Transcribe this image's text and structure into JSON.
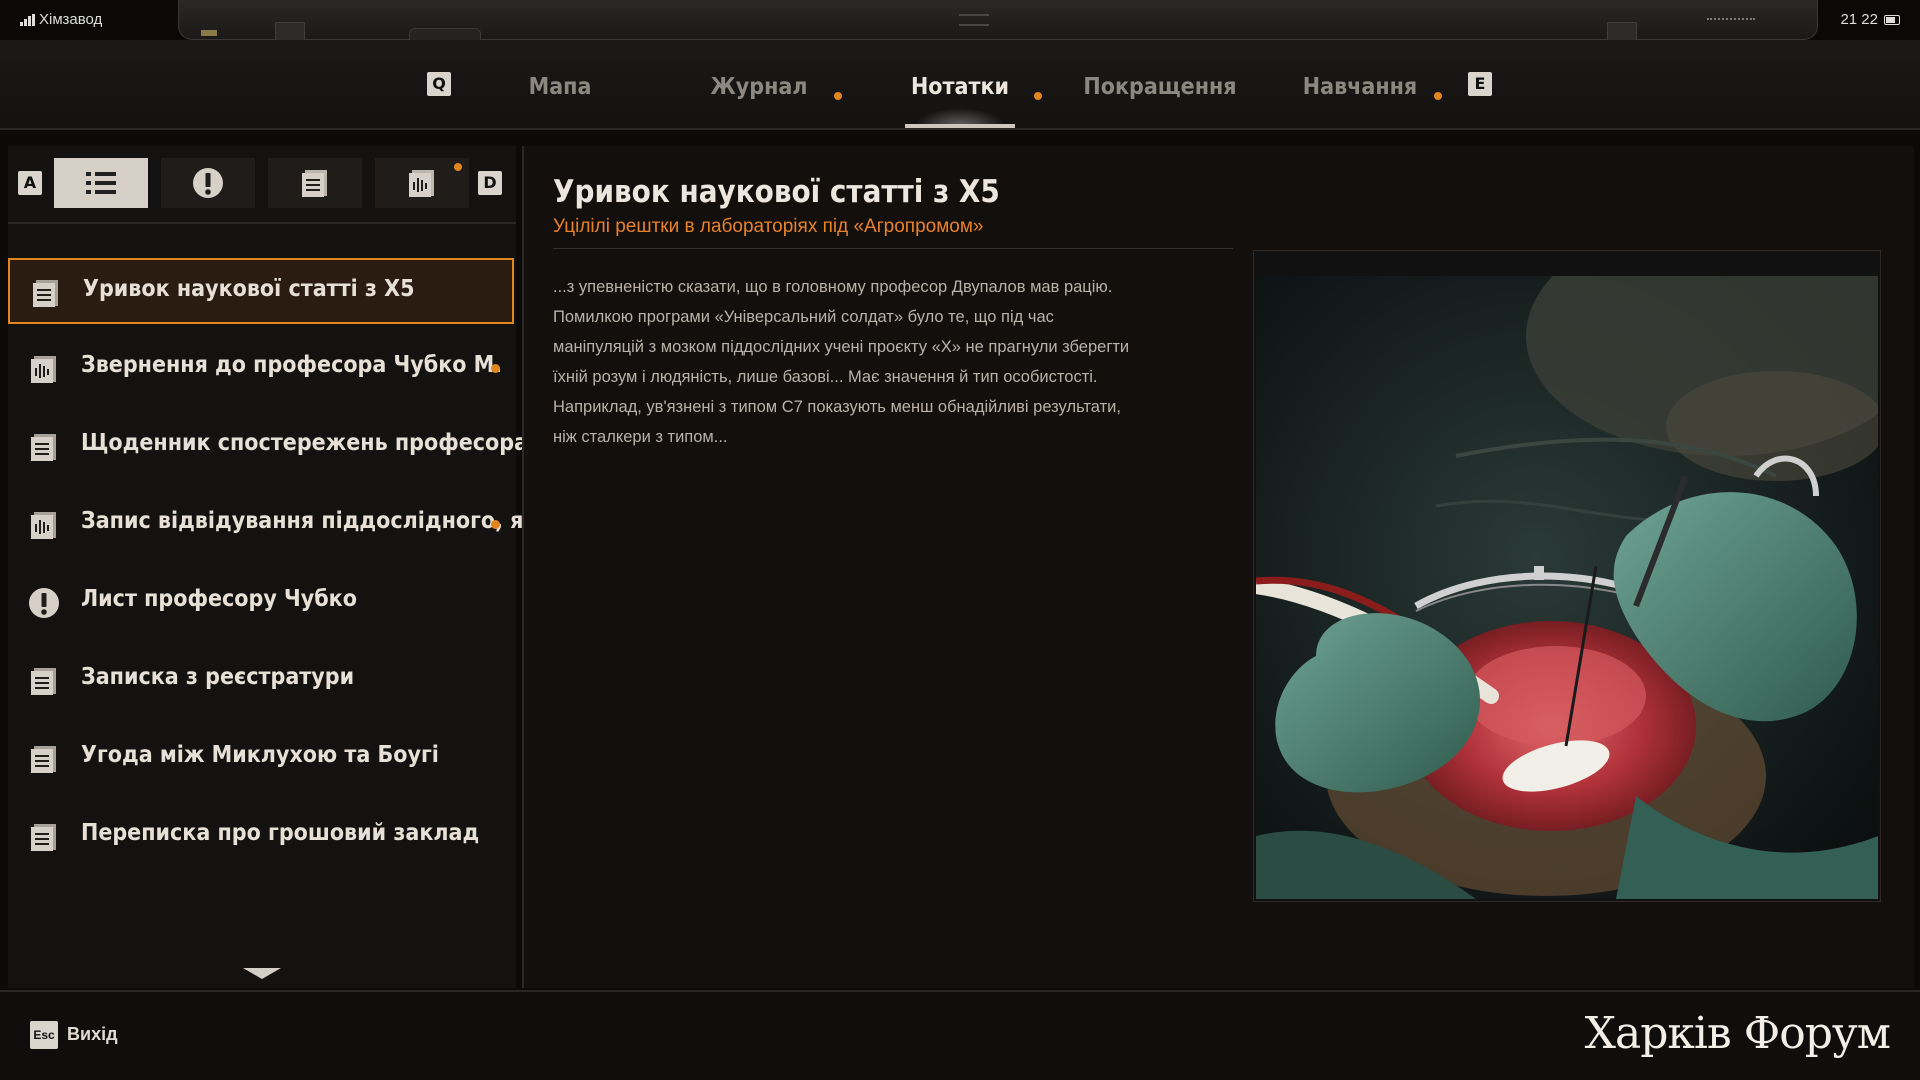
{
  "status_bar": {
    "carrier": "Хімзавод",
    "time": "21 22"
  },
  "nav": {
    "prev_key": "Q",
    "next_key": "E",
    "tabs": [
      {
        "label": "Мапа",
        "active": false,
        "notification": false
      },
      {
        "label": "Журнал",
        "active": false,
        "notification": true
      },
      {
        "label": "Нотатки",
        "active": true,
        "notification": true
      },
      {
        "label": "Покращення",
        "active": false,
        "notification": false
      },
      {
        "label": "Навчання",
        "active": false,
        "notification": true
      }
    ]
  },
  "filters": {
    "prev_key": "A",
    "next_key": "D",
    "tabs": [
      {
        "icon": "list-icon",
        "active": true,
        "notification": false
      },
      {
        "icon": "exclamation-icon",
        "active": false,
        "notification": false
      },
      {
        "icon": "document-icon",
        "active": false,
        "notification": false
      },
      {
        "icon": "audio-icon",
        "active": false,
        "notification": true
      }
    ]
  },
  "notes": [
    {
      "label": "Уривок наукової статті з Х5",
      "icon": "document-icon",
      "selected": true,
      "notification": false
    },
    {
      "label": "Звернення до професора Чубко М.",
      "icon": "audio-icon",
      "selected": false,
      "notification": true
    },
    {
      "label": "Щоденник спостережень професора Дву...",
      "icon": "document-icon",
      "selected": false,
      "notification": false
    },
    {
      "label": "Запис відвідування піддослідного, яки...",
      "icon": "audio-icon",
      "selected": false,
      "notification": true
    },
    {
      "label": "Лист професору Чубко",
      "icon": "exclamation-icon",
      "selected": false,
      "notification": false
    },
    {
      "label": "Записка з реєстратури",
      "icon": "document-icon",
      "selected": false,
      "notification": false
    },
    {
      "label": "Угода між Миклухою та Боугі",
      "icon": "document-icon",
      "selected": false,
      "notification": false
    },
    {
      "label": "Переписка про грошовий заклад",
      "icon": "document-icon",
      "selected": false,
      "notification": false
    }
  ],
  "document": {
    "title": "Уривок наукової статті з Х5",
    "subtitle": "Уцілілі рештки в лабораторіях під «Агропромом»",
    "body_lines": [
      "...з упевненістю сказати, що в головному професор Двупалов мав рацію.",
      "Помилкою програми «Універсальний солдат» було те, що під час",
      "маніпуляцій з мозком піддослідних учені проєкту «Х» не прагнули зберегти",
      "їхній розум і людяність, лише базові... Має значення й тип особистості.",
      "Наприклад, ув'язнені з типом С7 показують менш обнадійливі результати,",
      "ніж сталкери з типом..."
    ]
  },
  "bottom": {
    "exit_key": "Esc",
    "exit_label": "Вихід",
    "watermark": "Харків Форум"
  },
  "colors": {
    "accent": "#e0861c",
    "background": "#0c0a09",
    "panel": "#141210",
    "text": "#e7e0d6"
  }
}
